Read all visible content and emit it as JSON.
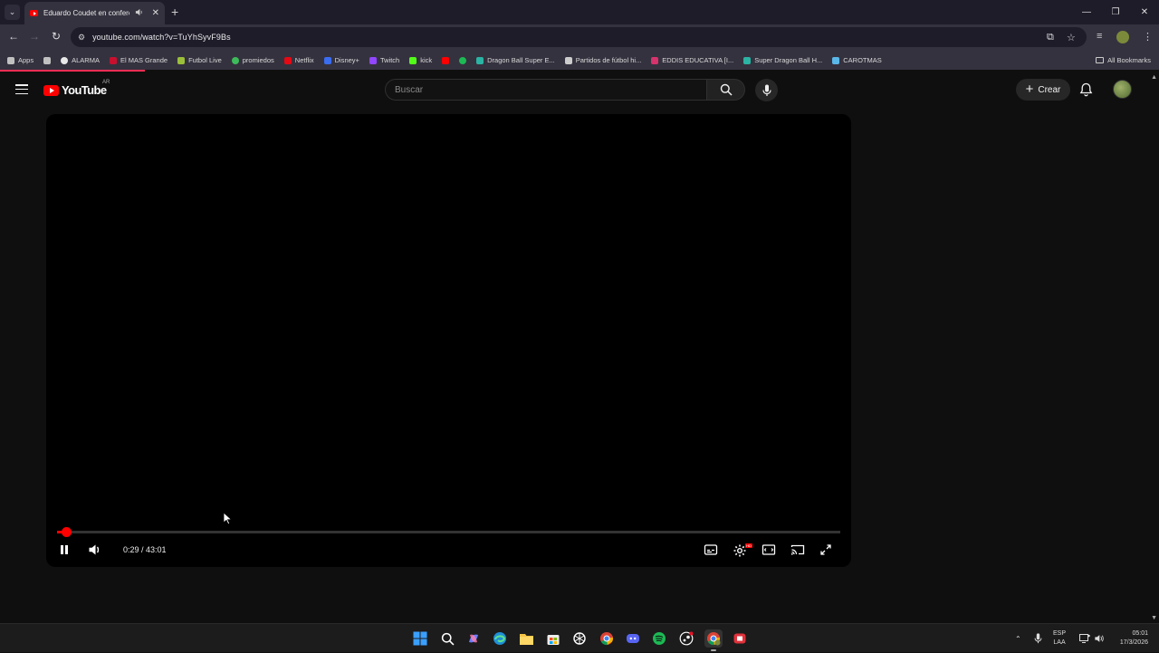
{
  "browser": {
    "tab": {
      "title": "Eduardo Coudet en conferencia",
      "audio_icon": "speaker-icon",
      "close_icon": "close-icon"
    },
    "new_tab_icon": "plus-icon",
    "window_controls": [
      "minimize-icon",
      "restore-icon",
      "close-icon"
    ],
    "url": "youtube.com/watch?v=TuYhSyvF9Bs",
    "bookmarks": [
      {
        "label": "Apps",
        "icon": "apps-grid-icon",
        "color": "#c0c0c0"
      },
      {
        "label": "",
        "icon": "tab-groups-icon",
        "color": "#c0c0c0"
      },
      {
        "label": "ALARMA",
        "icon": "clock-icon",
        "color": "#e8e8e8"
      },
      {
        "label": "El MAS Grande",
        "icon": "club-crest-icon",
        "color": "#c8102e"
      },
      {
        "label": "Futbol Live",
        "icon": "tv-icon",
        "color": "#9bbf3a"
      },
      {
        "label": "promiedos",
        "icon": "ball-icon",
        "color": "#3dbb5a"
      },
      {
        "label": "Netflix",
        "icon": "netflix-icon",
        "color": "#e50914"
      },
      {
        "label": "Disney+",
        "icon": "disney-icon",
        "color": "#3a6df0"
      },
      {
        "label": "Twitch",
        "icon": "twitch-icon",
        "color": "#9146ff"
      },
      {
        "label": "kick",
        "icon": "kick-icon",
        "color": "#53fc18"
      },
      {
        "label": "",
        "icon": "youtube-icon",
        "color": "#ff0000"
      },
      {
        "label": "",
        "icon": "spotify-icon",
        "color": "#1db954"
      },
      {
        "label": "Dragon Ball Super E...",
        "icon": "triangle-icon",
        "color": "#2bb3a3"
      },
      {
        "label": "Partidos de fútbol hi...",
        "icon": "github-icon",
        "color": "#cccccc"
      },
      {
        "label": "EDDIS EDUCATIVA [I...",
        "icon": "school-icon",
        "color": "#d6336c"
      },
      {
        "label": "Super Dragon Ball H...",
        "icon": "triangle-icon",
        "color": "#2bb3a3"
      },
      {
        "label": "CAROTMAS",
        "icon": "snowflake-icon",
        "color": "#5ab7e8"
      }
    ],
    "all_bookmarks": "All Bookmarks"
  },
  "youtube": {
    "logo_text": "YouTube",
    "region": "AR",
    "search_placeholder": "Buscar",
    "create_label": "Crear"
  },
  "player": {
    "current_time": "0:29",
    "duration": "43:01",
    "time_display": "0:29 / 43:01",
    "progress_fraction": 0.0112,
    "state": "playing",
    "controls": [
      "pause-icon",
      "volume-icon",
      "subtitles-icon",
      "settings-icon",
      "theater-mode-icon",
      "cast-icon",
      "fullscreen-icon"
    ],
    "settings_badge": "HD"
  },
  "taskbar": {
    "apps": [
      "windows-start-icon",
      "search-icon",
      "copilot-icon",
      "edge-icon",
      "file-explorer-icon",
      "store-icon",
      "chatgpt-icon",
      "chrome-icon",
      "discord-icon",
      "spotify-icon",
      "steam-icon",
      "chrome-profile-icon",
      "app-icon"
    ],
    "language": "ESP",
    "layout": "LAA",
    "time": "05:01",
    "date": "17/3/2026"
  },
  "colors": {
    "accent": "#ff0000",
    "bg": "#0f0f0f",
    "chrome": "#35323f"
  }
}
